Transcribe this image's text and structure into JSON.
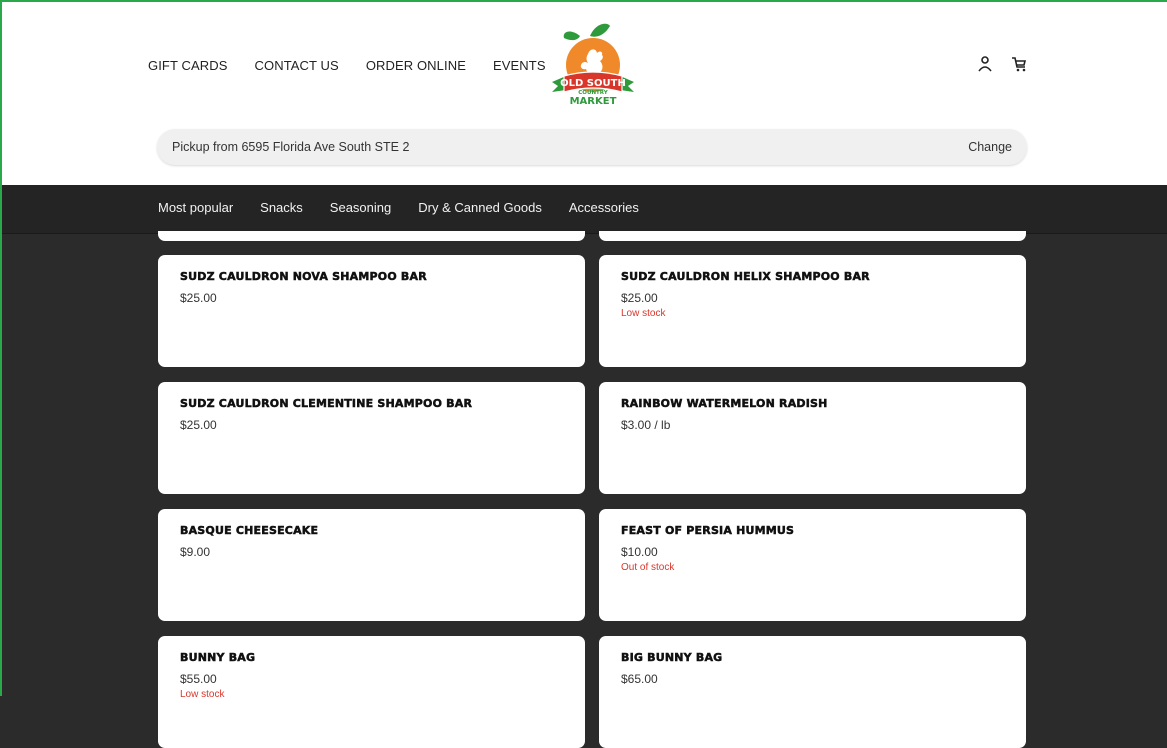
{
  "header": {
    "nav": [
      "GIFT CARDS",
      "CONTACT US",
      "ORDER ONLINE",
      "EVENTS"
    ],
    "logo": {
      "line1": "OLD SOUTH",
      "line2": "COUNTRY",
      "line3": "MARKET",
      "colors": {
        "orange": "#f0892a",
        "green": "#2e9a3c",
        "red": "#d9362b"
      }
    },
    "icons": [
      "account-icon",
      "cart-icon"
    ]
  },
  "pickup": {
    "text": "Pickup from 6595 Florida Ave South STE 2",
    "change_label": "Change"
  },
  "categories": [
    "Most popular",
    "Snacks",
    "Seasoning",
    "Dry & Canned Goods",
    "Accessories"
  ],
  "products": [
    {
      "name": "SUDZ CAULDRON NOVA SHAMPOO BAR",
      "price": "$25.00",
      "stock": ""
    },
    {
      "name": "SUDZ CAULDRON HELIX SHAMPOO BAR",
      "price": "$25.00",
      "stock": "Low stock"
    },
    {
      "name": "SUDZ CAULDRON CLEMENTINE SHAMPOO BAR",
      "price": "$25.00",
      "stock": ""
    },
    {
      "name": "RAINBOW WATERMELON RADISH",
      "price": "$3.00 / lb",
      "stock": ""
    },
    {
      "name": "BASQUE CHEESECAKE",
      "price": "$9.00",
      "stock": ""
    },
    {
      "name": "FEAST OF PERSIA HUMMUS",
      "price": "$10.00",
      "stock": "Out of stock"
    },
    {
      "name": "BUNNY BAG",
      "price": "$55.00",
      "stock": "Low stock"
    },
    {
      "name": "BIG BUNNY BAG",
      "price": "$65.00",
      "stock": ""
    }
  ],
  "theme": {
    "accent_red": "#d9362b",
    "dark_bg": "#2b2b2b",
    "frame_green": "#2aa84a"
  }
}
